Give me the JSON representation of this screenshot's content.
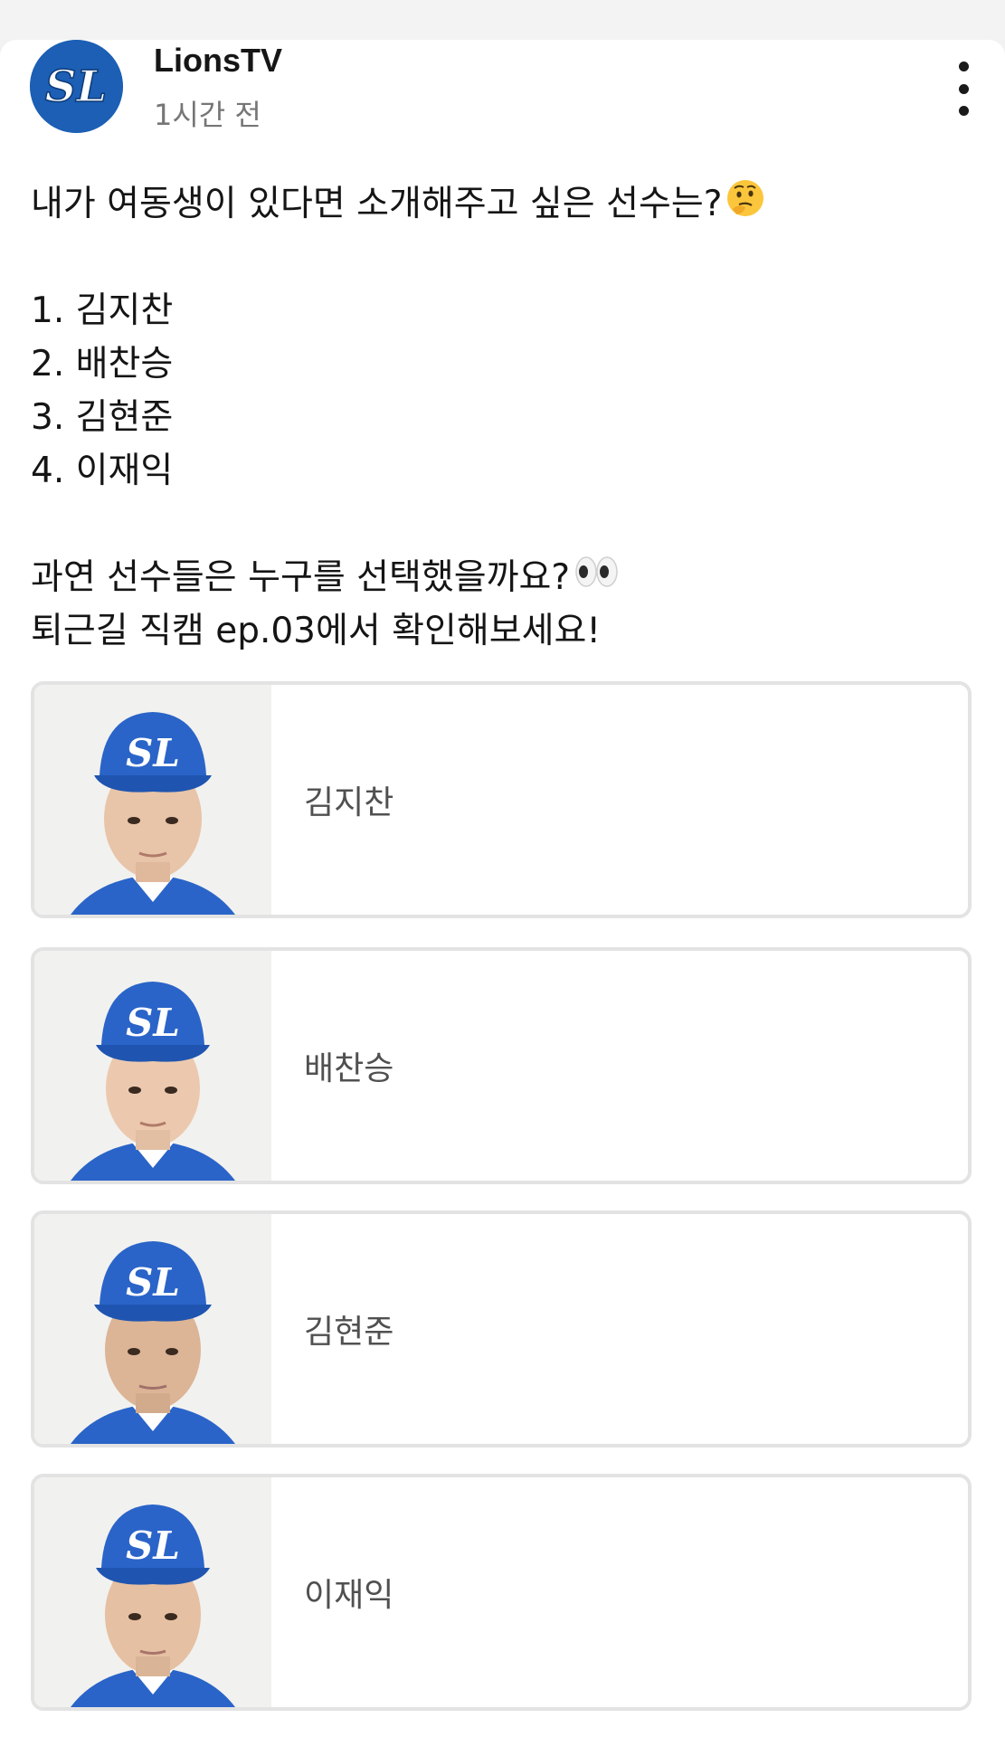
{
  "post": {
    "author": "LionsTV",
    "avatar_text": "SL",
    "time": "1시간 전",
    "lines": {
      "l1": "내가 여동생이 있다면 소개해주고 싶은 선수는?",
      "l2": "1. 김지찬",
      "l3": "2. 배찬승",
      "l4": "3. 김현준",
      "l5": "4. 이재익",
      "l6": "과연 선수들은 누구를 선택했을까요?",
      "l7": "퇴근길 직캠 ep.03에서 확인해보세요!"
    },
    "emojis": [
      "thinking-face",
      "eyes"
    ]
  },
  "poll": {
    "options": [
      {
        "label": "김지찬",
        "cap_text": "SL"
      },
      {
        "label": "배찬승",
        "cap_text": "SL"
      },
      {
        "label": "김현준",
        "cap_text": "SL"
      },
      {
        "label": "이재익",
        "cap_text": "SL"
      }
    ]
  },
  "colors": {
    "brand_blue": "#1c5fb4",
    "cap_blue": "#2a64c8"
  }
}
